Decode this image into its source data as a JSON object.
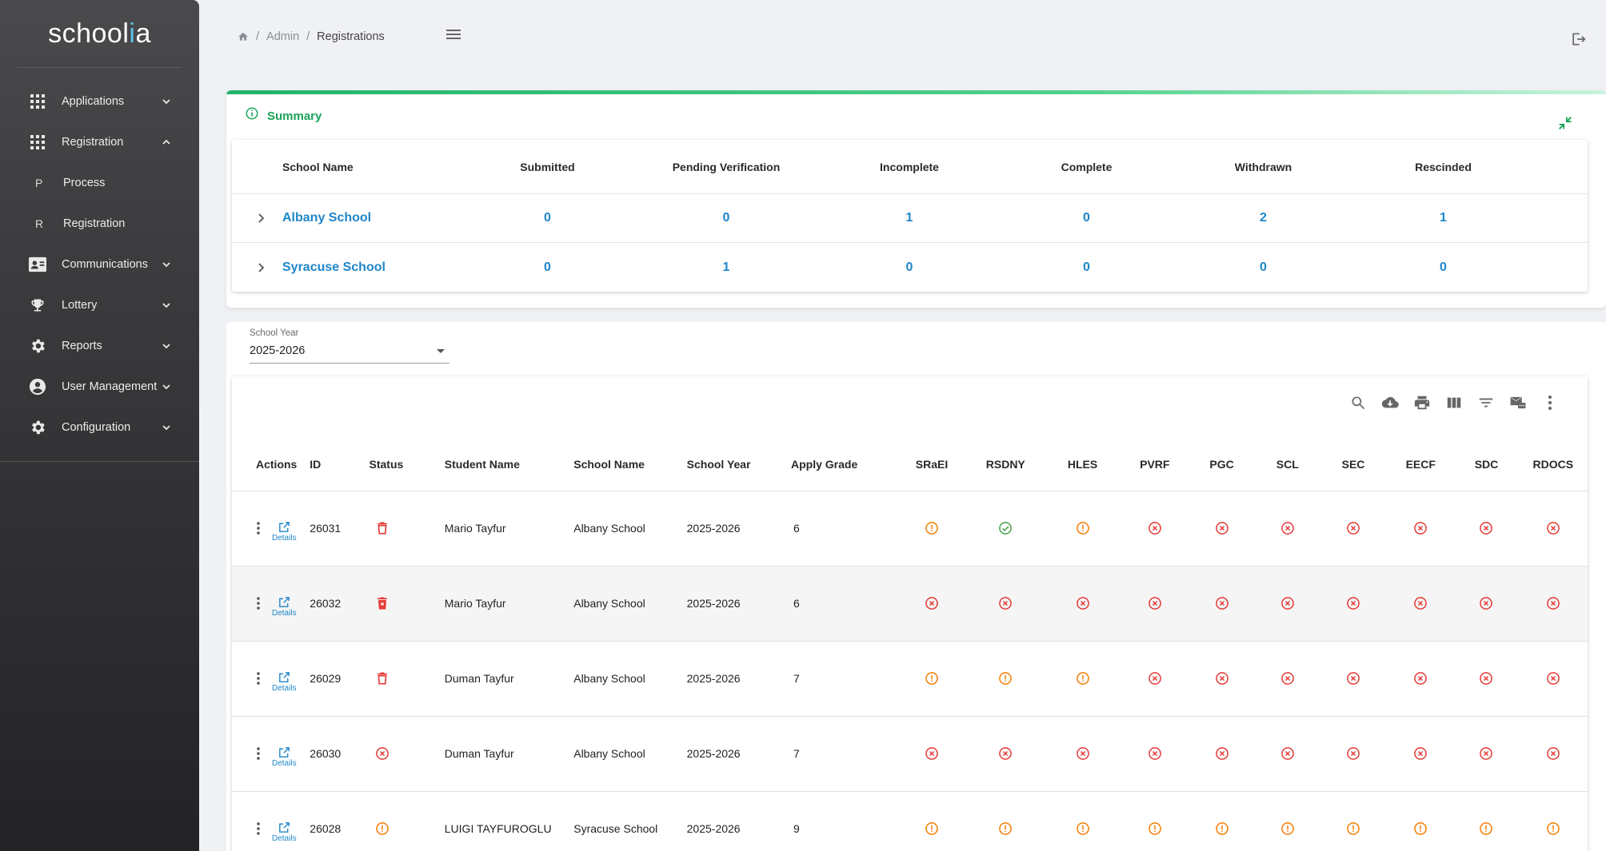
{
  "brand": {
    "name_main": "schoo",
    "name_l": "l",
    "name_accent": "i",
    "name_end": "a"
  },
  "sidebar": {
    "items": [
      {
        "label": "Applications",
        "icon": "grid-icon",
        "expanded": false
      },
      {
        "label": "Registration",
        "icon": "grid-icon",
        "expanded": true
      },
      {
        "label": "Process",
        "letter": "P",
        "sub": true
      },
      {
        "label": "Registration",
        "letter": "R",
        "sub": true
      },
      {
        "label": "Communications",
        "icon": "contact-card-icon",
        "expanded": false
      },
      {
        "label": "Lottery",
        "icon": "trophy-icon",
        "expanded": false
      },
      {
        "label": "Reports",
        "icon": "gear-icon",
        "expanded": false
      },
      {
        "label": "User Management",
        "icon": "account-circle-icon",
        "expanded": false
      },
      {
        "label": "Configuration",
        "icon": "gear-icon",
        "expanded": false
      }
    ]
  },
  "breadcrumb": {
    "home_icon": "home-icon",
    "admin": "Admin",
    "current": "Registrations",
    "sep": "/"
  },
  "summary": {
    "title": "Summary",
    "columns": [
      "School Name",
      "Submitted",
      "Pending Verification",
      "Incomplete",
      "Complete",
      "Withdrawn",
      "Rescinded"
    ],
    "rows": [
      {
        "school": "Albany School",
        "values": [
          "0",
          "0",
          "1",
          "0",
          "2",
          "1"
        ]
      },
      {
        "school": "Syracuse School",
        "values": [
          "0",
          "1",
          "0",
          "0",
          "0",
          "0"
        ]
      }
    ]
  },
  "filter": {
    "label": "School Year",
    "value": "2025-2026"
  },
  "grid": {
    "columns": [
      "Actions",
      "ID",
      "Status",
      "Student Name",
      "School Name",
      "School Year",
      "Apply Grade",
      "SRaEI",
      "RSDNY",
      "HLES",
      "PVRF",
      "PGC",
      "SCL",
      "SEC",
      "EECF",
      "SDC",
      "RDOCS"
    ],
    "details_label": "Details",
    "rows": [
      {
        "id": "26031",
        "status": "trash",
        "student": "Mario Tayfur",
        "school": "Albany School",
        "year": "2025-2026",
        "grade": "6",
        "checks": [
          "warn",
          "ok",
          "warn",
          "x",
          "x",
          "x",
          "x",
          "x",
          "x",
          "x"
        ]
      },
      {
        "id": "26032",
        "status": "trash-filled",
        "student": "Mario Tayfur",
        "school": "Albany School",
        "year": "2025-2026",
        "grade": "6",
        "checks": [
          "x",
          "x",
          "x",
          "x",
          "x",
          "x",
          "x",
          "x",
          "x",
          "x"
        ]
      },
      {
        "id": "26029",
        "status": "trash",
        "student": "Duman Tayfur",
        "school": "Albany School",
        "year": "2025-2026",
        "grade": "7",
        "checks": [
          "warn",
          "warn",
          "warn",
          "x",
          "x",
          "x",
          "x",
          "x",
          "x",
          "x"
        ]
      },
      {
        "id": "26030",
        "status": "x",
        "student": "Duman Tayfur",
        "school": "Albany School",
        "year": "2025-2026",
        "grade": "7",
        "checks": [
          "x",
          "x",
          "x",
          "x",
          "x",
          "x",
          "x",
          "x",
          "x",
          "x"
        ]
      },
      {
        "id": "26028",
        "status": "warn",
        "student": "LUIGI TAYFUROGLU",
        "school": "Syracuse School",
        "year": "2025-2026",
        "grade": "9",
        "checks": [
          "warn",
          "warn",
          "warn",
          "warn",
          "warn",
          "warn",
          "warn",
          "warn",
          "warn",
          "warn"
        ]
      }
    ]
  },
  "colors": {
    "accent_green": "#1aa35a",
    "link_blue": "#1f86c8",
    "error_red": "#e53935",
    "warn_orange": "#f57c00",
    "ok_green": "#43a047"
  }
}
